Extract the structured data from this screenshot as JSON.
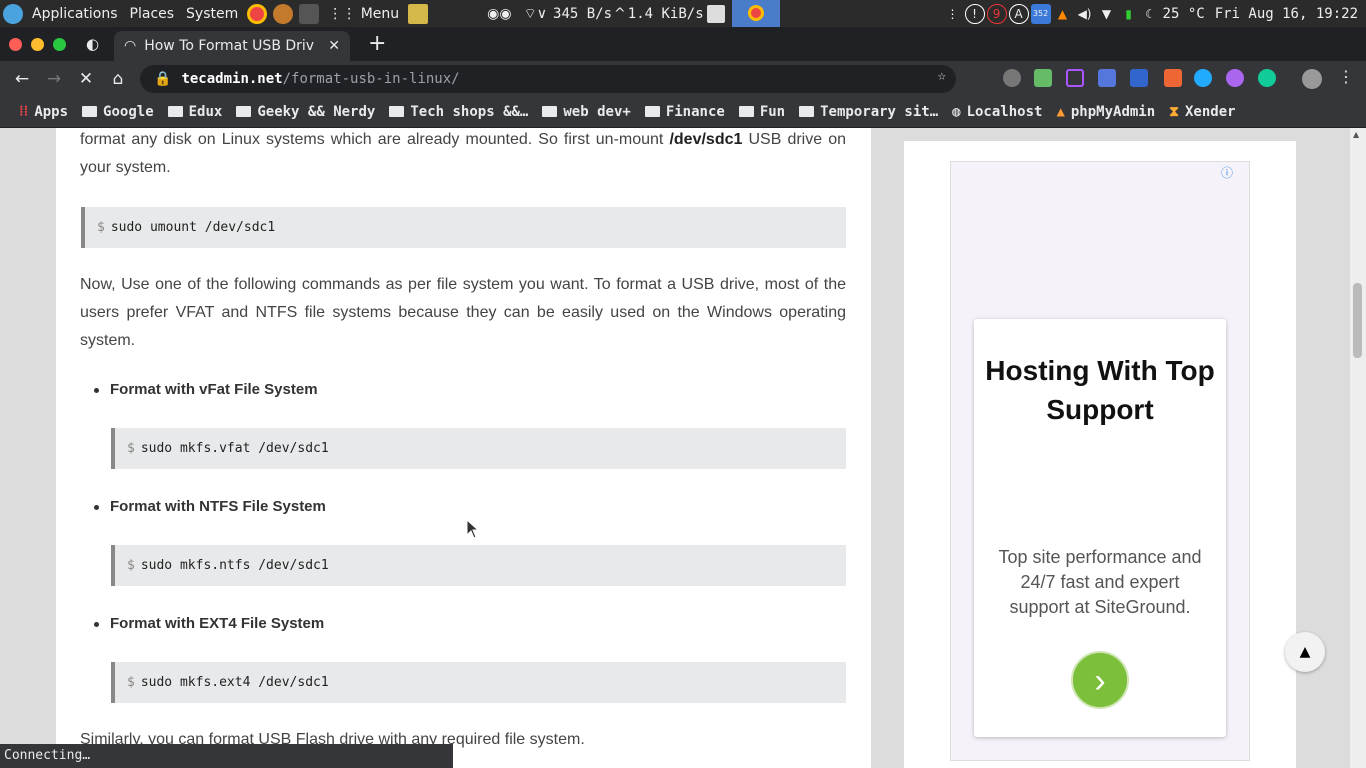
{
  "system_panel": {
    "menus": [
      "Applications",
      "Places",
      "System"
    ],
    "menu_label": "Menu",
    "network_down": "345 B/s",
    "network_up": "1.4 KiB/s",
    "temperature": "25 °C",
    "clock": "Fri Aug 16, 19:22",
    "badge_9": "9",
    "badge_352": "352"
  },
  "browser": {
    "tab_title": "How To Format USB Driv",
    "url_domain": "tecadmin.net",
    "url_path": "/format-usb-in-linux/",
    "status_text": "Connecting…",
    "bookmarks": [
      "Apps",
      "Google",
      "Edux",
      "Geeky && Nerdy",
      "Tech shops &&…",
      "web dev+",
      "Finance",
      "Fun",
      "Temporary sit…",
      "Localhost",
      "phpMyAdmin",
      "Xender"
    ]
  },
  "article": {
    "intro_before": "format any disk on Linux systems which are already mounted. So first un-mount ",
    "intro_device": "/dev/sdc1",
    "intro_after": " USB drive on your system.",
    "cmd_umount": "sudo umount /dev/sdc1",
    "para2": "Now, Use one of the following commands as per file system you want. To format a USB drive, most of the users prefer VFAT and NTFS file systems because they can be easily used on the Windows operating system.",
    "bullet_vfat": "Format with vFat File System",
    "cmd_vfat": "sudo mkfs.vfat /dev/sdc1",
    "bullet_ntfs": "Format with NTFS File System",
    "cmd_ntfs": "sudo mkfs.ntfs /dev/sdc1",
    "bullet_ext4": "Format with EXT4 File System",
    "cmd_ext4": "sudo mkfs.ext4 /dev/sdc1",
    "closing": "Similarly, you can format USB Flash drive with any required file system.",
    "prompt": "$"
  },
  "ad": {
    "headline": "Hosting With Top Support",
    "body": "Top site performance and 24/7 fast and expert support at SiteGround.",
    "info_icon": "ⓘ"
  },
  "colors": {
    "ad_button": "#7cbf3b",
    "code_bg": "#e8e9ea"
  }
}
